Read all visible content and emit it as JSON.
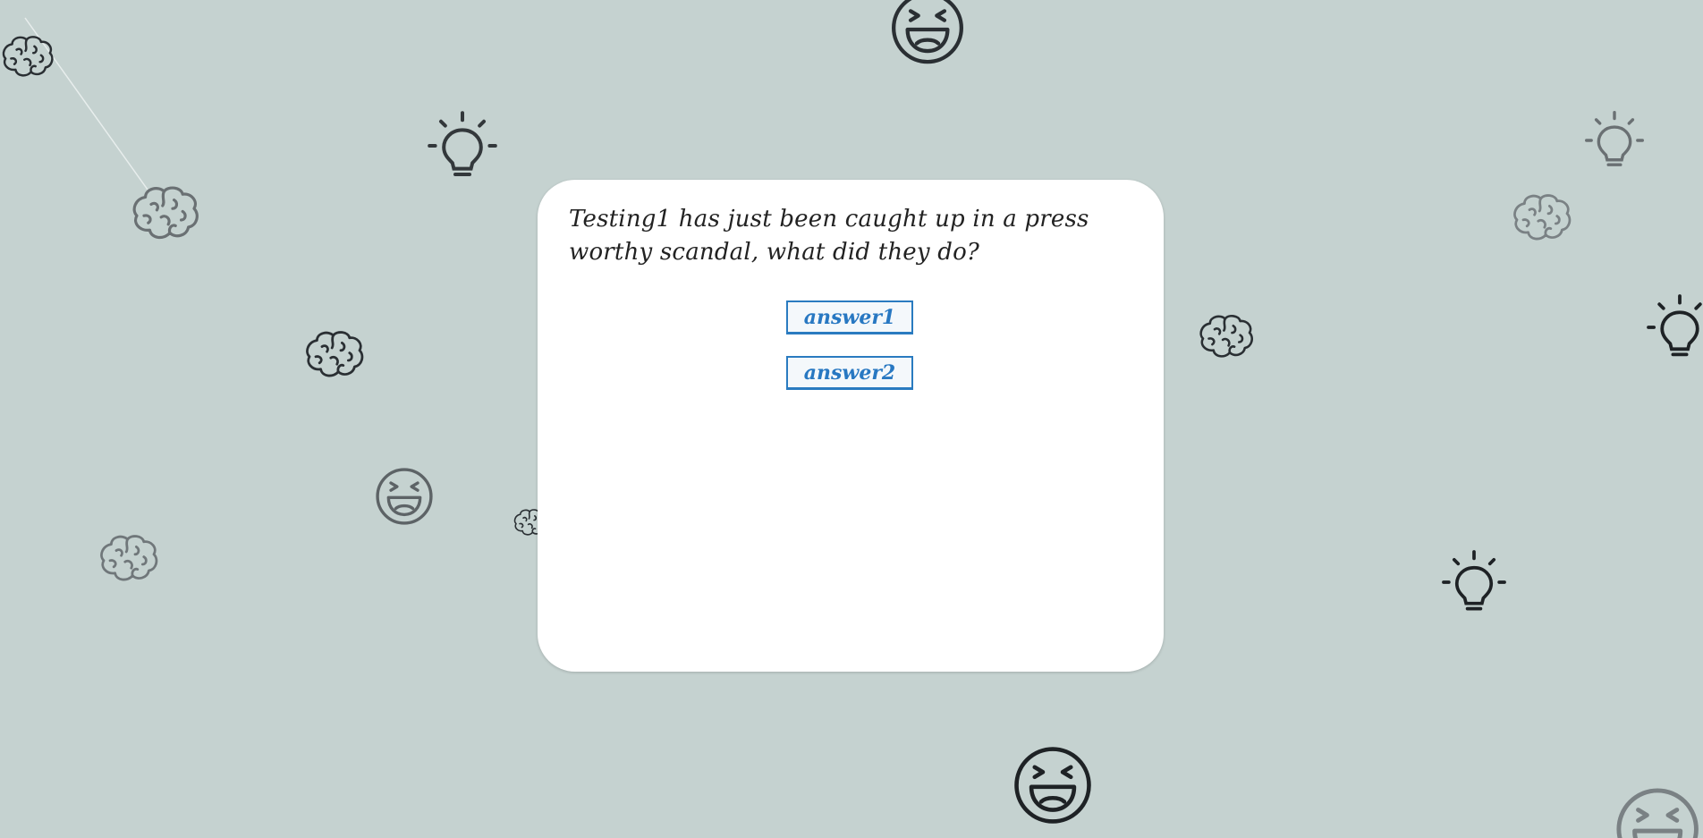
{
  "page": {
    "background_color": "#c5d2d0"
  },
  "background_icons": [
    {
      "name": "brain-icon",
      "color": "#2a2f33"
    },
    {
      "name": "brain-icon",
      "color": "#6a7073"
    },
    {
      "name": "lightbulb-icon",
      "color": "#33383b"
    },
    {
      "name": "laughing-face-icon",
      "color": "#2a2f33"
    },
    {
      "name": "brain-icon",
      "color": "#2a2f33"
    },
    {
      "name": "laughing-face-icon",
      "color": "#5d6366"
    },
    {
      "name": "brain-icon",
      "color": "#70777a"
    },
    {
      "name": "brain-icon",
      "color": "#2a2f33"
    },
    {
      "name": "brain-icon",
      "color": "#2a2f33"
    },
    {
      "name": "lightbulb-icon",
      "color": "#6a7073"
    },
    {
      "name": "brain-icon",
      "color": "#7a8184"
    },
    {
      "name": "lightbulb-icon",
      "color": "#1e2225"
    },
    {
      "name": "lightbulb-icon",
      "color": "#1e2225"
    },
    {
      "name": "laughing-face-icon",
      "color": "#1e2225"
    },
    {
      "name": "laughing-face-icon",
      "color": "#7a8184"
    }
  ],
  "modal": {
    "question": "Testing1 has just been caught up in a press worthy scandal, what did they do?",
    "answers": [
      "answer1",
      "answer2"
    ],
    "accent_color": "#2878c2"
  }
}
